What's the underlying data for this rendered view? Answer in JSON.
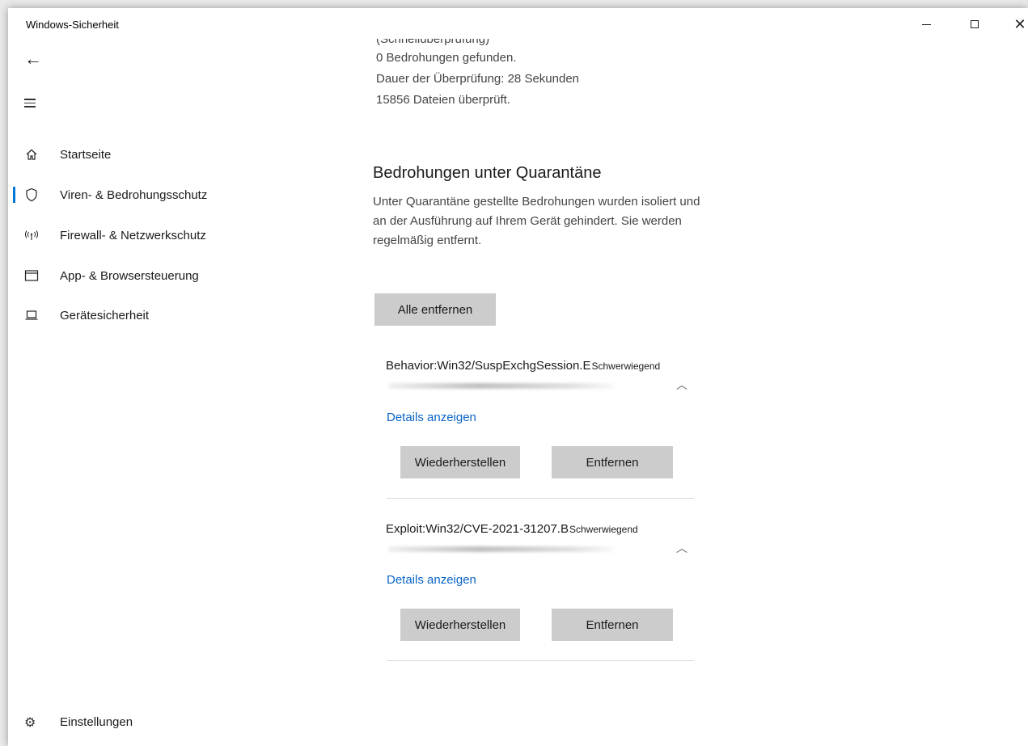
{
  "window": {
    "title": "Windows-Sicherheit",
    "minimize_icon": "minimize-icon",
    "maximize_icon": "maximize-icon",
    "close_icon": "close-icon"
  },
  "nav": {
    "back_icon": "back-arrow-icon",
    "menu_icon": "hamburger-icon",
    "items": [
      {
        "label": "Startseite",
        "icon": "home-icon",
        "active": false
      },
      {
        "label": "Viren- & Bedrohungsschutz",
        "icon": "shield-icon",
        "active": true
      },
      {
        "label": "Firewall- & Netzwerkschutz",
        "icon": "antenna-icon",
        "active": false
      },
      {
        "label": "App- & Browsersteuerung",
        "icon": "browser-window-icon",
        "active": false
      },
      {
        "label": "Gerätesicherheit",
        "icon": "laptop-icon",
        "active": false
      }
    ],
    "settings": {
      "label": "Einstellungen",
      "icon": "gear-icon"
    }
  },
  "scan": {
    "line0": "(Schnellüberprüfung)",
    "line1": "0 Bedrohungen gefunden.",
    "line2": "Dauer der Überprüfung: 28 Sekunden",
    "line3": "15856 Dateien überprüft."
  },
  "quarantine": {
    "heading": "Bedrohungen unter Quarantäne",
    "description": "Unter Quarantäne gestellte Bedrohungen wurden isoliert und an der Ausführung auf Ihrem Gerät gehindert. Sie werden regelmäßig entfernt.",
    "remove_all_label": "Alle entfernen",
    "threats": [
      {
        "name": "Behavior:Win32/SuspExchgSession.E",
        "severity": "Schwerwiegend",
        "details_label": "Details anzeigen",
        "restore_label": "Wiederherstellen",
        "remove_label": "Entfernen"
      },
      {
        "name": "Exploit:Win32/CVE-2021-31207.B",
        "severity": "Schwerwiegend",
        "details_label": "Details anzeigen",
        "restore_label": "Wiederherstellen",
        "remove_label": "Entfernen"
      }
    ]
  }
}
